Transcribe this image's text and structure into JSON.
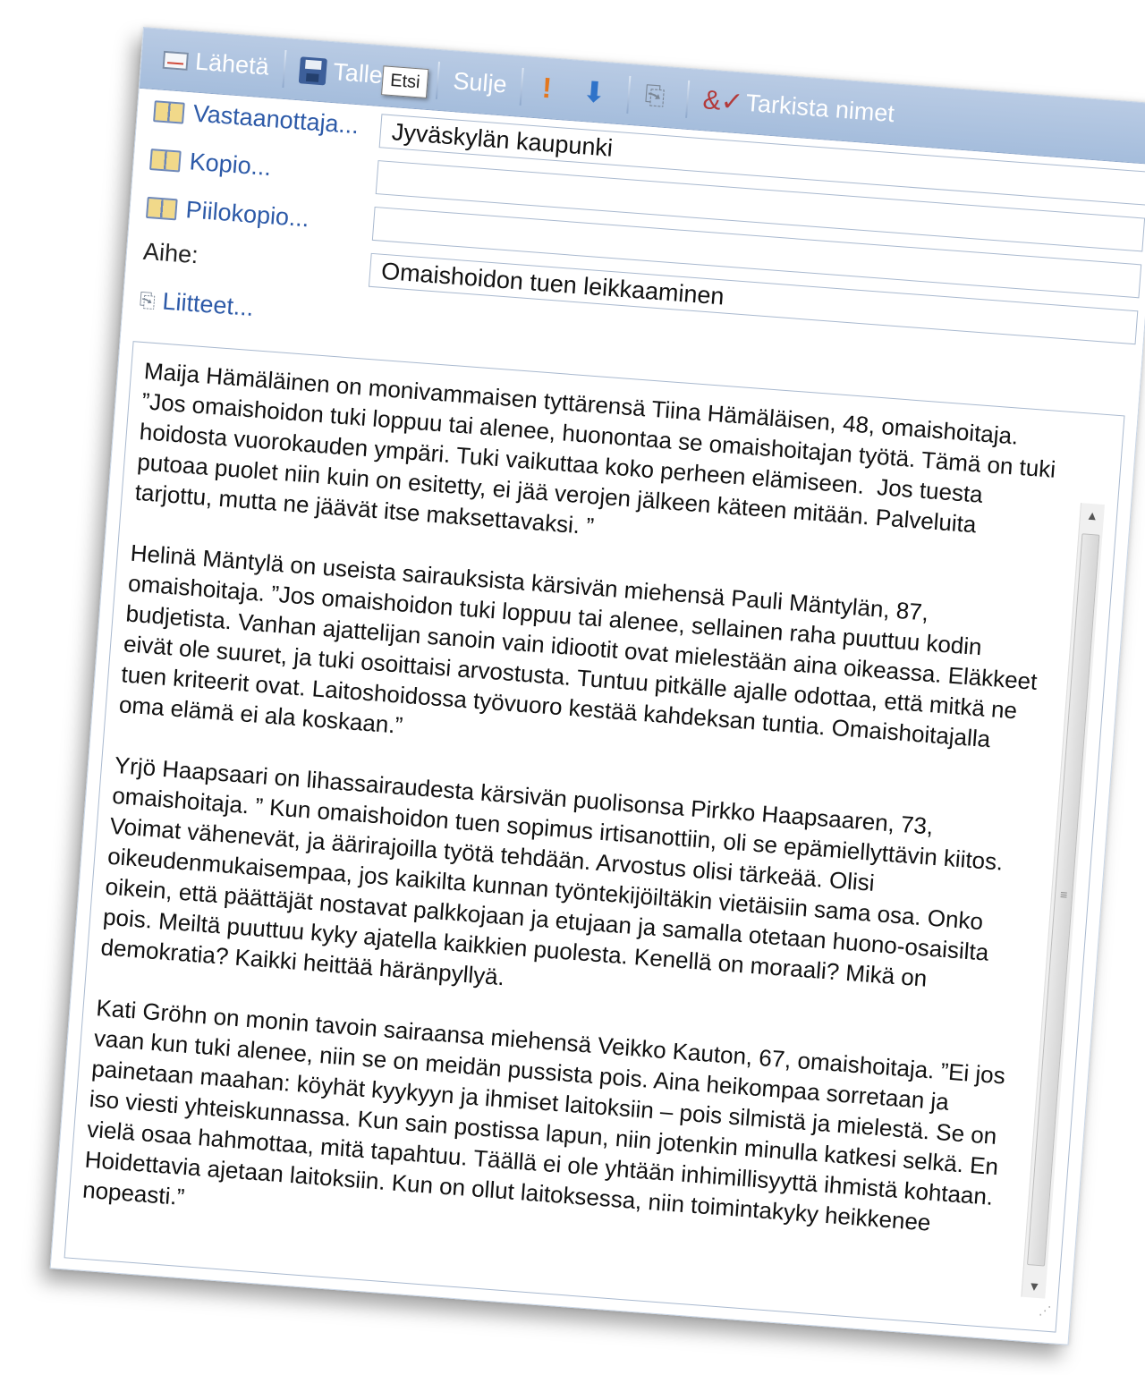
{
  "toolbar": {
    "send_label": "Lähetä",
    "save_label": "Tallenna",
    "close_label": "Sulje",
    "check_names_label": "Tarkista nimet",
    "tooltip": "Etsi"
  },
  "header": {
    "to_label": "Vastaanottaja...",
    "to_value": "Jyväskylän kaupunki",
    "cc_label": "Kopio...",
    "cc_value": "",
    "bcc_label": "Piilokopio...",
    "bcc_value": "",
    "subject_label": "Aihe:",
    "subject_value": "Omaishoidon tuen leikkaaminen",
    "attachments_label": "Liitteet..."
  },
  "body": {
    "paragraphs": [
      "Maija Hämäläinen on monivammaisen tyttärensä Tiina Hämäläisen, 48, omaishoitaja. ”Jos omaishoidon tuki loppuu tai alenee, huonontaa se omaishoitajan työtä. Tämä on tuki hoidosta vuorokauden ympäri. Tuki vaikuttaa koko perheen elämiseen.  Jos tuesta putoaa puolet niin kuin on esitetty, ei jää verojen jälkeen käteen mitään. Palveluita tarjottu, mutta ne jäävät itse maksettavaksi. ”",
      "Helinä Mäntylä on useista sairauksista kärsivän miehensä Pauli Mäntylän, 87, omaishoitaja. ”Jos omaishoidon tuki loppuu tai alenee, sellainen raha puuttuu kodin budjetista. Vanhan ajattelijan sanoin vain idiootit ovat mielestään aina oikeassa. Eläkkeet eivät ole suuret, ja tuki osoittaisi arvostusta. Tuntuu pitkälle ajalle odottaa, että mitkä ne tuen kriteerit ovat. Laitoshoidossa työvuoro kestää kahdeksan tuntia. Omaishoitajalla oma elämä ei ala koskaan.”",
      "Yrjö Haapsaari on lihassairaudesta kärsivän puolisonsa Pirkko Haapsaaren, 73, omaishoitaja. ” Kun omaishoidon tuen sopimus irtisanottiin, oli se epämiellyttävin kiitos. Voimat vähenevät, ja äärirajoilla työtä tehdään. Arvostus olisi tärkeää. Olisi oikeudenmukaisempaa, jos kaikilta kunnan työntekijöiltäkin vietäisiin sama osa. Onko oikein, että päättäjät nostavat palkkojaan ja etujaan ja samalla otetaan huono-osaisilta pois. Meiltä puuttuu kyky ajatella kaikkien puolesta. Kenellä on moraali? Mikä on demokratia? Kaikki heittää häränpyllyä.",
      "Kati Gröhn on monin tavoin sairaansa miehensä Veikko Kauton, 67, omaishoitaja. ”Ei jos vaan kun tuki alenee, niin se on meidän pussista pois. Aina heikompaa sorretaan ja painetaan maahan: köyhät kyykyyn ja ihmiset laitoksiin – pois silmistä ja mielestä. Se on iso viesti yhteiskunnassa. Kun sain postissa lapun, niin jotenkin minulla katkesi selkä. En vielä osaa hahmottaa, mitä tapahtuu. Täällä ei ole yhtään inhimillisyyttä ihmistä kohtaan. Hoidettavia ajetaan laitoksiin. Kun on ollut laitoksessa, niin toimintakyky heikkenee nopeasti.”"
    ]
  },
  "colors": {
    "toolbar_bg": "#a5bddc",
    "link_blue": "#2d5aa8",
    "field_border": "#a9b9cf"
  },
  "icons": [
    "mail-icon",
    "save-icon",
    "importance-high-icon",
    "importance-low-icon",
    "attach-icon",
    "check-names-icon",
    "address-book-icon",
    "paperclip-icon"
  ]
}
